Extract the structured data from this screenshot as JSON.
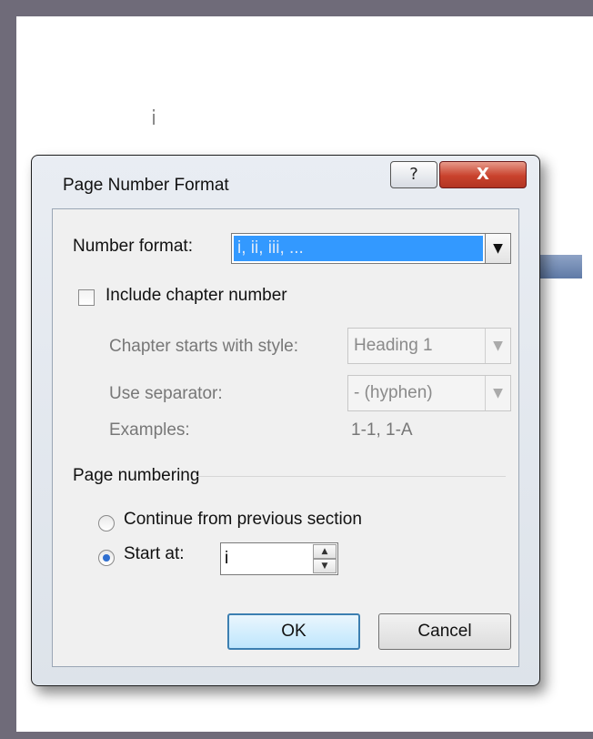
{
  "document": {
    "page_char": "i"
  },
  "dialog": {
    "title": "Page Number Format",
    "help_label": "?",
    "close_label": "X",
    "number_format": {
      "label": "Number format:",
      "value": "i, ii, iii, ..."
    },
    "include_chapter": {
      "label": "Include chapter number",
      "checked": false
    },
    "chapter_style": {
      "label": "Chapter starts with style:",
      "value": "Heading 1"
    },
    "separator": {
      "label": "Use separator:",
      "value": "-  (hyphen)"
    },
    "examples": {
      "label": "Examples:",
      "value": "1-1, 1-A"
    },
    "page_numbering": {
      "heading": "Page numbering",
      "continue_label": "Continue from previous section",
      "start_label": "Start at:",
      "start_value": "i",
      "selected": "start_at"
    },
    "ok_label": "OK",
    "cancel_label": "Cancel"
  },
  "icons": {
    "dropdown": "chevron-down-icon",
    "spin_up": "arrow-up-icon",
    "spin_down": "arrow-down-icon"
  },
  "colors": {
    "selection": "#3399ff",
    "close_button": "#c9422d",
    "default_button_border": "#3c7fb1"
  }
}
